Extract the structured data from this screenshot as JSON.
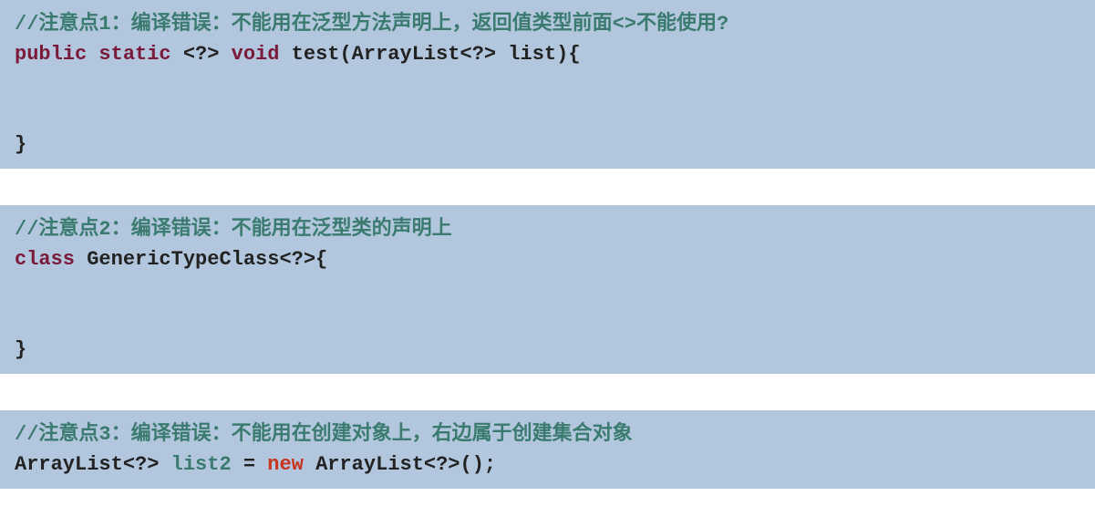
{
  "block1": {
    "comment": "//注意点1：编译错误：不能用在泛型方法声明上，返回值类型前面<>不能使用?",
    "kw_public": "public",
    "kw_static": "static",
    "generic": "<?>",
    "kw_void": "void",
    "method": "test(ArrayList<?> list){",
    "close": "}"
  },
  "block2": {
    "comment": "//注意点2：编译错误：不能用在泛型类的声明上",
    "kw_class": "class",
    "classname": "GenericTypeClass<?>{",
    "close": "}"
  },
  "block3": {
    "comment": "//注意点3：编译错误：不能用在创建对象上，右边属于创建集合对象",
    "lhs_type": "ArrayList<?>",
    "var": "list2",
    "eq": "=",
    "kw_new": "new",
    "rhs": "ArrayList<?>();"
  }
}
